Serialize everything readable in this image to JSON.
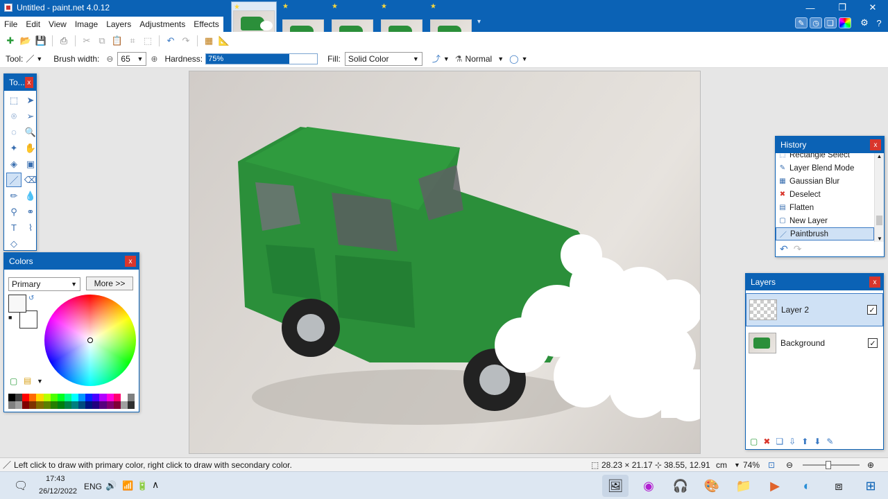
{
  "window": {
    "title": "Untitled - paint.net 4.0.12",
    "thumbnail_count": 5,
    "controls": {
      "minimize": "—",
      "restore": "❐",
      "close": "✕"
    }
  },
  "menu": [
    "File",
    "Edit",
    "View",
    "Image",
    "Layers",
    "Adjustments",
    "Effects"
  ],
  "toolbar": {
    "tool_label": "Tool:",
    "brush_width_label": "Brush width:",
    "brush_width_value": "65",
    "hardness_label": "Hardness:",
    "hardness_value": "75%",
    "hardness_fraction": 0.75,
    "fill_label": "Fill:",
    "fill_value": "Solid Color",
    "blend_value": "Normal"
  },
  "tools_panel": {
    "title": "To..."
  },
  "colors_panel": {
    "title": "Colors",
    "mode": "Primary",
    "more_button": "More >>",
    "palette_top": [
      "#000000",
      "#404040",
      "#ff0000",
      "#ff6a00",
      "#ffd800",
      "#b6ff00",
      "#4cff00",
      "#00ff21",
      "#00ff90",
      "#00ffff",
      "#0094ff",
      "#0026ff",
      "#4800ff",
      "#b200ff",
      "#ff00dc",
      "#ff006e",
      "#ffffff",
      "#808080"
    ],
    "palette_bottom": [
      "#808080",
      "#a0a0a0",
      "#7f0000",
      "#7f3300",
      "#7f6a00",
      "#5b7f00",
      "#267f00",
      "#007f0e",
      "#007f46",
      "#007f7f",
      "#004a7f",
      "#00137f",
      "#21007f",
      "#57007f",
      "#7f006e",
      "#7f0037",
      "#a0a0a0",
      "#303030"
    ]
  },
  "history_panel": {
    "title": "History",
    "items": [
      {
        "label": "Rectangle Select",
        "icon": "rect-select-icon"
      },
      {
        "label": "Layer Blend Mode",
        "icon": "layer-props-icon"
      },
      {
        "label": "Gaussian Blur",
        "icon": "blur-icon"
      },
      {
        "label": "Deselect",
        "icon": "deselect-icon"
      },
      {
        "label": "Flatten",
        "icon": "flatten-icon"
      },
      {
        "label": "New Layer",
        "icon": "new-layer-icon"
      },
      {
        "label": "Paintbrush",
        "icon": "paintbrush-icon",
        "selected": true
      }
    ]
  },
  "layers_panel": {
    "title": "Layers",
    "layers": [
      {
        "name": "Layer 2",
        "visible": true,
        "selected": true
      },
      {
        "name": "Background",
        "visible": true,
        "selected": false
      }
    ]
  },
  "status": {
    "hint": "Left click to draw with primary color, right click to draw with secondary color.",
    "size": "28.23 × 21.17",
    "cursor": "38.55, 12.91",
    "unit": "cm",
    "zoom": "74%"
  },
  "taskbar": {
    "time": "17:43",
    "date": "26/12/2022",
    "lang": "ENG"
  },
  "colors": {
    "titlebar": "#0b62b5",
    "accent": "#3b7ac4",
    "paint_green": "#2b8f3a",
    "close_red": "#d9362c"
  }
}
